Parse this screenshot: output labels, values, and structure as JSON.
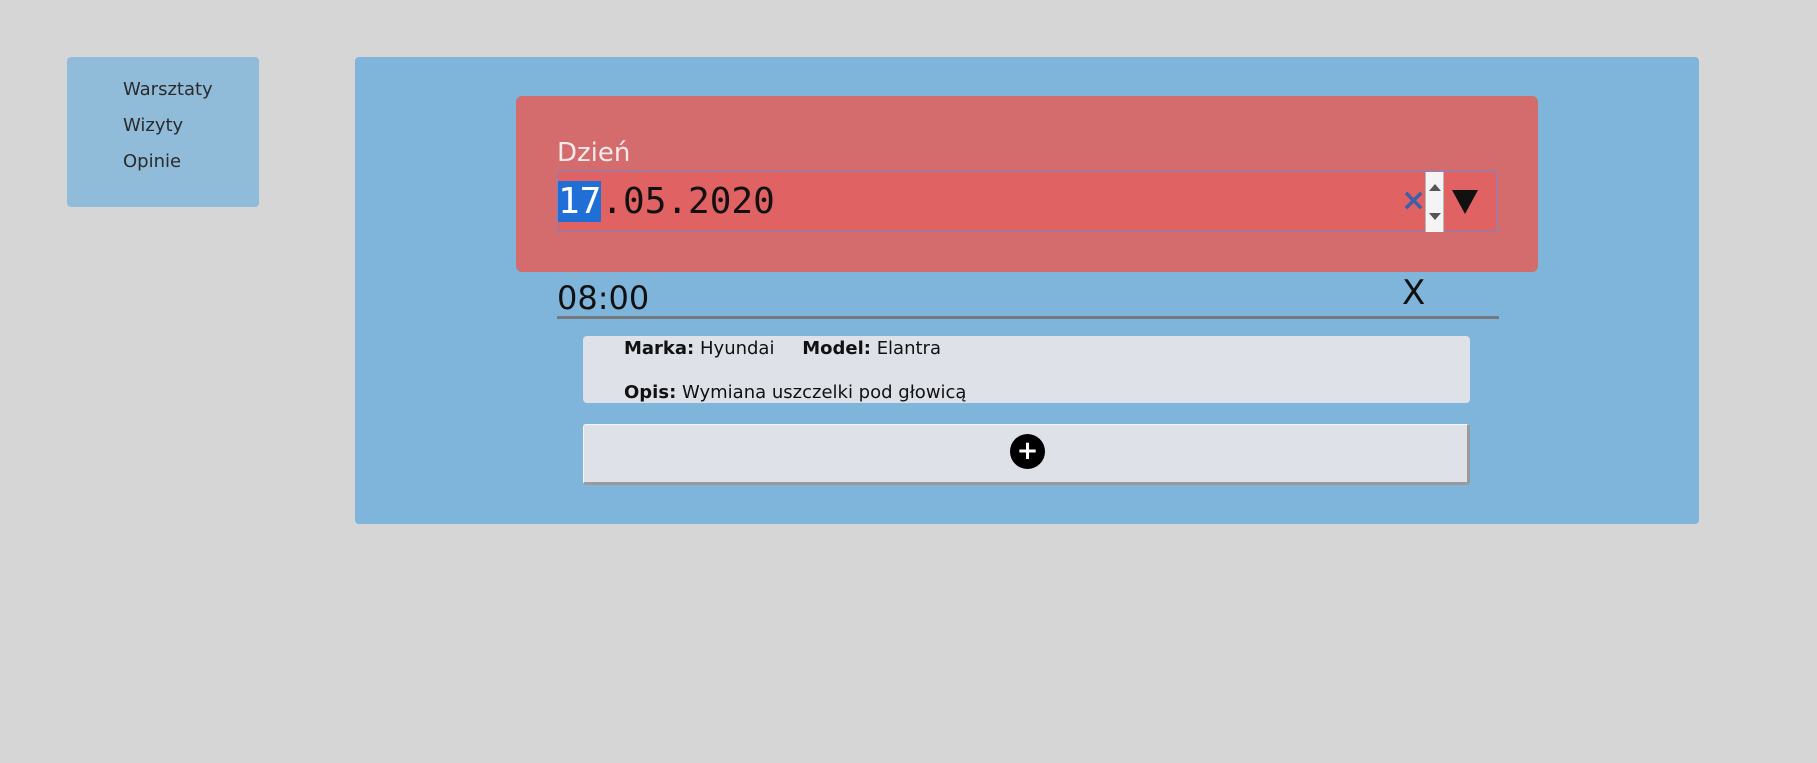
{
  "sidebar": {
    "items": [
      {
        "label": "Warsztaty"
      },
      {
        "label": "Wizyty"
      },
      {
        "label": "Opinie"
      }
    ]
  },
  "date_card": {
    "label": "Dzień",
    "day": "17",
    "rest": ".05.2020",
    "clear_symbol": "×",
    "dropdown_icon": "triangle-down-icon"
  },
  "time": {
    "value": "08:00",
    "close_symbol": "X"
  },
  "visit": {
    "brand_label": "Marka:",
    "brand_value": "Hyundai",
    "model_label": "Model:",
    "model_value": "Elantra",
    "desc_label": "Opis:",
    "desc_value": "Wymiana uszczelki pod głowicą"
  },
  "add_button": {
    "symbol": "+"
  },
  "colors": {
    "page_bg": "#d6d6d6",
    "sidebar_bg": "#90bcda",
    "panel_bg": "#7fb5da",
    "date_card_bg": "#d46b6d",
    "selection": "#1f6fd6"
  }
}
